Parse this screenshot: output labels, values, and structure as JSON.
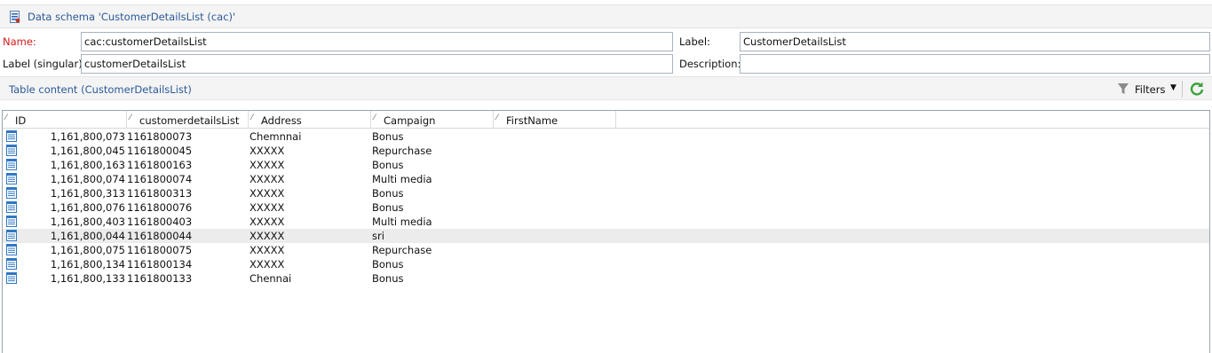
{
  "header": {
    "title": "Data schema 'CustomerDetailsList (cac)'",
    "icon": "schema-document-icon"
  },
  "form": {
    "name_label": "Name:",
    "name_value": "cac:customerDetailsList",
    "label_label": "Label:",
    "label_value": "CustomerDetailsList",
    "singular_label": "Label (singular):",
    "singular_value": "customerDetailsList",
    "description_label": "Description:",
    "description_value": ""
  },
  "section": {
    "title": "Table content (CustomerDetailsList)",
    "filters_label": "Filters",
    "filters_icon": "funnel-icon",
    "refresh_icon": "refresh-icon"
  },
  "table": {
    "columns": [
      "ID",
      "customerdetailsList",
      "Address",
      "Campaign",
      "FirstName"
    ],
    "selected_row": 7,
    "rows": [
      {
        "id": "1,161,800,073",
        "cdl": "1161800073",
        "address": "Chemnnai",
        "campaign": "Bonus",
        "firstname": ""
      },
      {
        "id": "1,161,800,045",
        "cdl": "1161800045",
        "address": "XXXXX",
        "campaign": "Repurchase",
        "firstname": ""
      },
      {
        "id": "1,161,800,163",
        "cdl": "1161800163",
        "address": "XXXXX",
        "campaign": "Bonus",
        "firstname": ""
      },
      {
        "id": "1,161,800,074",
        "cdl": "1161800074",
        "address": "XXXXX",
        "campaign": "Multi media",
        "firstname": ""
      },
      {
        "id": "1,161,800,313",
        "cdl": "1161800313",
        "address": "XXXXX",
        "campaign": "Bonus",
        "firstname": ""
      },
      {
        "id": "1,161,800,076",
        "cdl": "1161800076",
        "address": "XXXXX",
        "campaign": "Bonus",
        "firstname": ""
      },
      {
        "id": "1,161,800,403",
        "cdl": "1161800403",
        "address": "XXXXX",
        "campaign": "Multi media",
        "firstname": ""
      },
      {
        "id": "1,161,800,044",
        "cdl": "1161800044",
        "address": "XXXXX",
        "campaign": "sri",
        "firstname": ""
      },
      {
        "id": "1,161,800,075",
        "cdl": "1161800075",
        "address": "XXXXX",
        "campaign": "Repurchase",
        "firstname": ""
      },
      {
        "id": "1,161,800,134",
        "cdl": "1161800134",
        "address": "XXXXX",
        "campaign": "Bonus",
        "firstname": ""
      },
      {
        "id": "1,161,800,133",
        "cdl": "1161800133",
        "address": "Chennai",
        "campaign": "Bonus",
        "firstname": ""
      }
    ]
  },
  "colors": {
    "title_blue": "#2a5a9a",
    "required_red": "#d21a1a",
    "row_icon_blue": "#2f78c4",
    "refresh_green": "#3aa33a"
  }
}
